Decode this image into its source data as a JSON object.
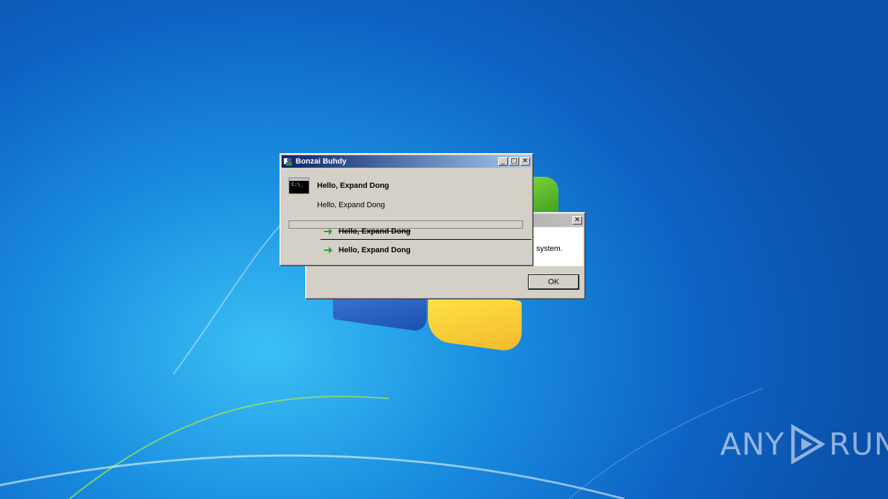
{
  "back_dialog": {
    "close_glyph": "✕",
    "message_fragment": "system.",
    "ok_label": "OK"
  },
  "main_dialog": {
    "title": "Bonzai Buhdy",
    "minimize_glyph": "_",
    "maximize_glyph": "□",
    "close_glyph": "✕",
    "heading": "Hello, Expand Dong",
    "body_text": "Hello, Expand Dong",
    "option_1": "Hello, Expand Dong",
    "option_2": "Hello, Expand Dong",
    "icon": "command-prompt-icon"
  },
  "watermark": {
    "left_text": "ANY",
    "right_text": "RUN"
  },
  "colors": {
    "title_active": "#0a246a",
    "dialog_face": "#d4d0c8",
    "arrow_green": "#1fa82c"
  }
}
